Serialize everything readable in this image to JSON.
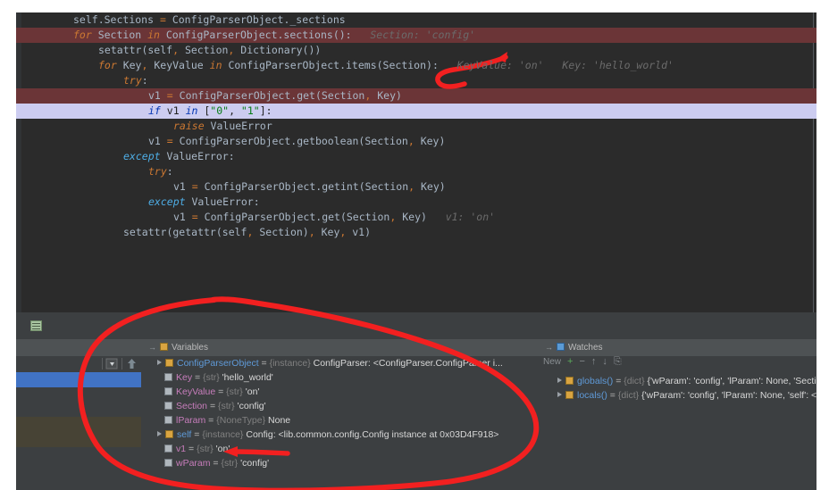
{
  "editor": {
    "name": "pycharm-code-editor",
    "language": "python",
    "theme_bg": "#2b2b2b",
    "breakpoint_line_color": "#6b3537",
    "current_line_color": "#ccccf0",
    "lines": [
      {
        "indent": 4,
        "marker": "none",
        "tokens": [
          {
            "t": "self",
            "c": "id"
          },
          {
            "t": ".Sections ",
            "c": "id"
          },
          {
            "t": "=",
            "c": "kw2"
          },
          {
            "t": " ConfigParserObject._sections",
            "c": "id"
          }
        ]
      },
      {
        "indent": 4,
        "marker": "breakpoint",
        "tokens": [
          {
            "t": "for",
            "c": "kw"
          },
          {
            "t": " Section ",
            "c": "id"
          },
          {
            "t": "in",
            "c": "kw"
          },
          {
            "t": " ConfigParserObject.sections()",
            "c": "id"
          },
          {
            "t": ":",
            "c": "op"
          }
        ],
        "hint": "Section: 'config'"
      },
      {
        "indent": 8,
        "marker": "none",
        "tokens": [
          {
            "t": "setattr(self",
            "c": "id"
          },
          {
            "t": ",",
            "c": "kw2"
          },
          {
            "t": " Section",
            "c": "id"
          },
          {
            "t": ",",
            "c": "kw2"
          },
          {
            "t": " Dictionary())",
            "c": "id"
          }
        ]
      },
      {
        "indent": 8,
        "marker": "none",
        "tokens": [
          {
            "t": "for",
            "c": "kw"
          },
          {
            "t": " Key",
            "c": "id"
          },
          {
            "t": ",",
            "c": "kw2"
          },
          {
            "t": " KeyValue ",
            "c": "id"
          },
          {
            "t": "in",
            "c": "kw"
          },
          {
            "t": " ConfigParserObject.items(Section)",
            "c": "id"
          },
          {
            "t": ":",
            "c": "op"
          }
        ],
        "hint": "KeyValue: 'on'   Key: 'hello_world'"
      },
      {
        "indent": 12,
        "marker": "none",
        "tokens": [
          {
            "t": "try",
            "c": "kw"
          },
          {
            "t": ":",
            "c": "op"
          }
        ]
      },
      {
        "indent": 16,
        "marker": "breakpoint",
        "tokens": [
          {
            "t": "v1 ",
            "c": "id"
          },
          {
            "t": "=",
            "c": "kw2"
          },
          {
            "t": " ConfigParserObject.get(Section",
            "c": "id"
          },
          {
            "t": ",",
            "c": "kw2"
          },
          {
            "t": " Key)",
            "c": "id"
          }
        ]
      },
      {
        "indent": 16,
        "marker": "current",
        "tokens": [
          {
            "t": "if",
            "c": "kw"
          },
          {
            "t": " v1 ",
            "c": "id"
          },
          {
            "t": "in",
            "c": "kw"
          },
          {
            "t": " [",
            "c": "id"
          },
          {
            "t": "\"0\"",
            "c": "str"
          },
          {
            "t": ", ",
            "c": "id"
          },
          {
            "t": "\"1\"",
            "c": "str"
          },
          {
            "t": "]:",
            "c": "id"
          }
        ]
      },
      {
        "indent": 20,
        "marker": "none",
        "tokens": [
          {
            "t": "raise",
            "c": "kw"
          },
          {
            "t": " ValueError",
            "c": "id"
          }
        ]
      },
      {
        "indent": 16,
        "marker": "none",
        "tokens": [
          {
            "t": "v1 ",
            "c": "id"
          },
          {
            "t": "=",
            "c": "kw2"
          },
          {
            "t": " ConfigParserObject.getboolean(Section",
            "c": "id"
          },
          {
            "t": ",",
            "c": "kw2"
          },
          {
            "t": " Key)",
            "c": "id"
          }
        ]
      },
      {
        "indent": 12,
        "marker": "none",
        "tokens": [
          {
            "t": "except",
            "c": "blue-kw"
          },
          {
            "t": " ValueError",
            "c": "id"
          },
          {
            "t": ":",
            "c": "op"
          }
        ]
      },
      {
        "indent": 16,
        "marker": "none",
        "tokens": [
          {
            "t": "try",
            "c": "kw"
          },
          {
            "t": ":",
            "c": "op"
          }
        ]
      },
      {
        "indent": 20,
        "marker": "none",
        "tokens": [
          {
            "t": "v1 ",
            "c": "id"
          },
          {
            "t": "=",
            "c": "kw2"
          },
          {
            "t": " ConfigParserObject.getint(Section",
            "c": "id"
          },
          {
            "t": ",",
            "c": "kw2"
          },
          {
            "t": " Key)",
            "c": "id"
          }
        ]
      },
      {
        "indent": 16,
        "marker": "none",
        "tokens": [
          {
            "t": "except",
            "c": "blue-kw"
          },
          {
            "t": " ValueError",
            "c": "id"
          },
          {
            "t": ":",
            "c": "op"
          }
        ]
      },
      {
        "indent": 20,
        "marker": "none",
        "tokens": [
          {
            "t": "v1 ",
            "c": "id"
          },
          {
            "t": "=",
            "c": "kw2"
          },
          {
            "t": " ConfigParserObject.get(Section",
            "c": "id"
          },
          {
            "t": ",",
            "c": "kw2"
          },
          {
            "t": " Key)",
            "c": "id"
          }
        ],
        "hint": "v1: 'on'"
      },
      {
        "indent": 12,
        "marker": "none",
        "tokens": [
          {
            "t": "setattr(getattr(self",
            "c": "id"
          },
          {
            "t": ",",
            "c": "kw2"
          },
          {
            "t": " Section)",
            "c": "id"
          },
          {
            "t": ",",
            "c": "kw2"
          },
          {
            "t": " Key",
            "c": "id"
          },
          {
            "t": ",",
            "c": "kw2"
          },
          {
            "t": " v1)",
            "c": "id"
          }
        ]
      }
    ]
  },
  "debug_panel": {
    "name": "debugger-tool-window",
    "tabs": {
      "variables_label": "Variables",
      "watches_label": "Watches"
    },
    "frames_toolbar": {
      "dropdown_label": "▾",
      "step_up_label": "▲",
      "step_down_label": "▼",
      "resume_label": "▶"
    },
    "watch_toolbar": {
      "new_label": "New",
      "add_label": "+",
      "remove_label": "−",
      "up_label": "↑",
      "down_label": "↓",
      "copy_label": "⎘"
    },
    "variables": [
      {
        "expandable": true,
        "icon": "object-icon",
        "name": "ConfigParserObject",
        "eq": "=",
        "type": "{instance}",
        "value": "ConfigParser: <ConfigParser.ConfigParser i..."
      },
      {
        "expandable": false,
        "icon": "field-icon",
        "name": "Key",
        "eq": "=",
        "type": "{str}",
        "value": "'hello_world'"
      },
      {
        "expandable": false,
        "icon": "field-icon",
        "name": "KeyValue",
        "eq": "=",
        "type": "{str}",
        "value": "'on'"
      },
      {
        "expandable": false,
        "icon": "field-icon",
        "name": "Section",
        "eq": "=",
        "type": "{str}",
        "value": "'config'"
      },
      {
        "expandable": false,
        "icon": "field-icon",
        "name": "lParam",
        "eq": "=",
        "type": "{NoneType}",
        "value": "None"
      },
      {
        "expandable": true,
        "icon": "object-icon",
        "name": "self",
        "eq": "=",
        "type": "{instance}",
        "value": "Config: <lib.common.config.Config instance at 0x03D4F918>"
      },
      {
        "expandable": false,
        "icon": "field-icon",
        "name": "v1",
        "eq": "=",
        "type": "{str}",
        "value": "'on'"
      },
      {
        "expandable": false,
        "icon": "field-icon",
        "name": "wParam",
        "eq": "=",
        "type": "{str}",
        "value": "'config'"
      }
    ],
    "watches": [
      {
        "expandable": true,
        "icon": "object-icon",
        "name": "globals()",
        "eq": "=",
        "type": "{dict}",
        "value": "{'wParam': 'config', 'lParam': None, 'Section"
      },
      {
        "expandable": true,
        "icon": "object-icon",
        "name": "locals()",
        "eq": "=",
        "type": "{dict}",
        "value": "{'wParam': 'config', 'lParam': None, 'self': <lib"
      }
    ],
    "frames": {
      "selected_row_color": "#4173c4",
      "highlight_row_color": "#474335"
    }
  },
  "annotations": {
    "name": "red-ink-markup",
    "color": "#f02020",
    "shapes": [
      {
        "kind": "arrow",
        "target": "inline-hint-keyvalue"
      },
      {
        "kind": "arrow",
        "target": "variable-v1"
      },
      {
        "kind": "ellipse",
        "target": "variables-pane-circle"
      }
    ]
  }
}
